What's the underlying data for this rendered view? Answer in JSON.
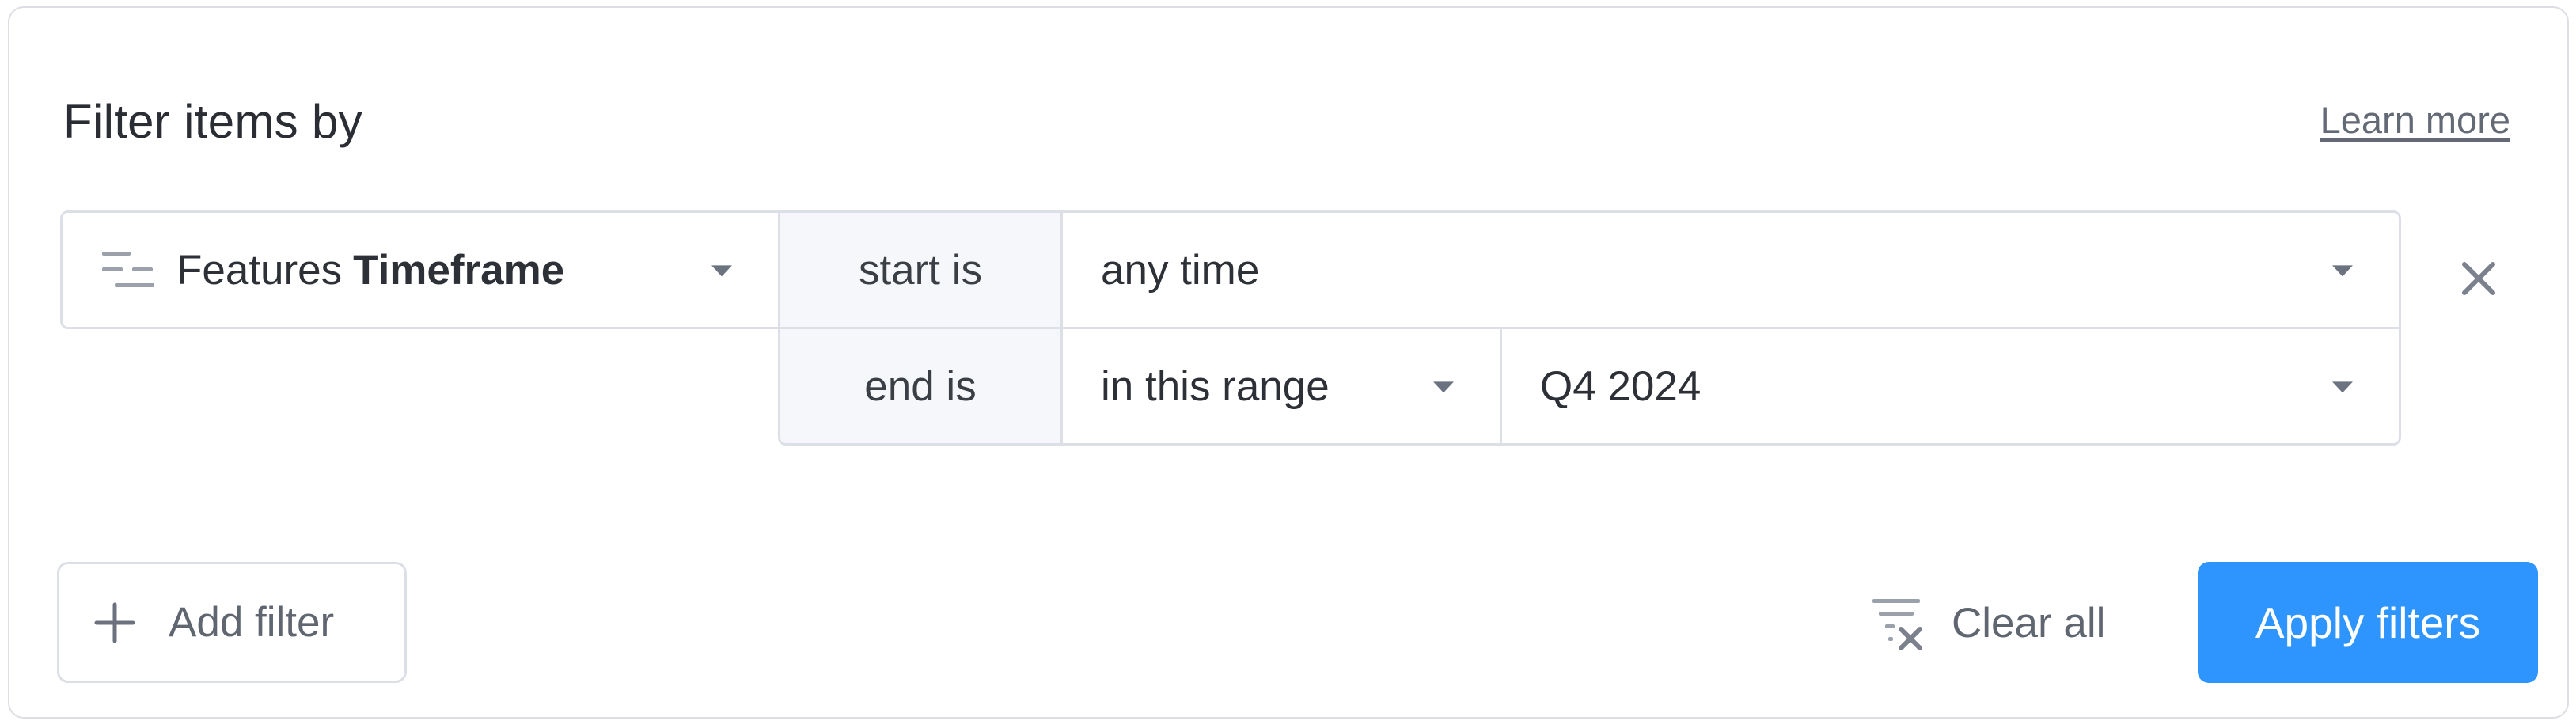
{
  "header": {
    "title": "Filter items by",
    "learn_more": "Learn more"
  },
  "filter": {
    "field_prefix": "Features",
    "field_name": "Timeframe",
    "field_icon": "list-filter-icon",
    "rows": [
      {
        "operator": "start is",
        "value": "any time"
      },
      {
        "operator": "end is",
        "range_mode": "in this range",
        "value": "Q4 2024"
      }
    ],
    "remove_icon": "close-icon"
  },
  "footer": {
    "add_filter": "Add filter",
    "clear_all": "Clear all",
    "apply": "Apply filters"
  },
  "colors": {
    "accent": "#2e95ff",
    "border": "#dcdfe5",
    "muted_text": "#5f6670"
  }
}
